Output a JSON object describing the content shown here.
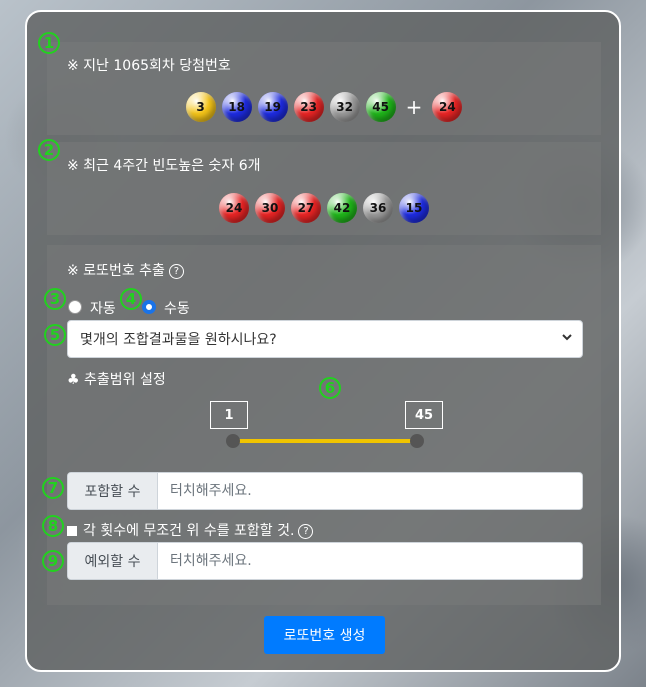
{
  "last_draw": {
    "heading": "※ 지난 1065회차 당첨번호",
    "balls": [
      {
        "n": "3",
        "color": "#f5c518"
      },
      {
        "n": "18",
        "color": "#1d2be0"
      },
      {
        "n": "19",
        "color": "#1d2be0"
      },
      {
        "n": "23",
        "color": "#e82424"
      },
      {
        "n": "32",
        "color": "#9a9a9a"
      },
      {
        "n": "45",
        "color": "#1fb51a"
      }
    ],
    "plus": "+",
    "bonus": {
      "n": "24",
      "color": "#e82424"
    }
  },
  "frequent": {
    "heading": "※ 최근 4주간 빈도높은 숫자 6개",
    "balls": [
      {
        "n": "24",
        "color": "#e82424"
      },
      {
        "n": "30",
        "color": "#e82424"
      },
      {
        "n": "27",
        "color": "#e82424"
      },
      {
        "n": "42",
        "color": "#1fb51a"
      },
      {
        "n": "36",
        "color": "#9a9a9a"
      },
      {
        "n": "15",
        "color": "#1d2be0"
      }
    ]
  },
  "extract": {
    "heading": "※ 로또번호 추출",
    "help": "?",
    "radio_auto": "자동",
    "radio_manual": "수동",
    "select_value": "몇개의 조합결과물을 원하시나요?",
    "select_chevron": "chevron-down-icon",
    "range_heading": "♣ 추출범위 설정",
    "range_min": "1",
    "range_max": "45",
    "include_label": "포함할 수",
    "include_placeholder": "터치해주세요.",
    "checkbox_label": "각 횟수에 무조건 위 수를 포함할 것.",
    "exclude_label": "예외할 수",
    "exclude_placeholder": "터치해주세요.",
    "generate_button": "로또번호 생성"
  },
  "markers": [
    "1",
    "2",
    "3",
    "4",
    "5",
    "6",
    "7",
    "8",
    "9"
  ]
}
